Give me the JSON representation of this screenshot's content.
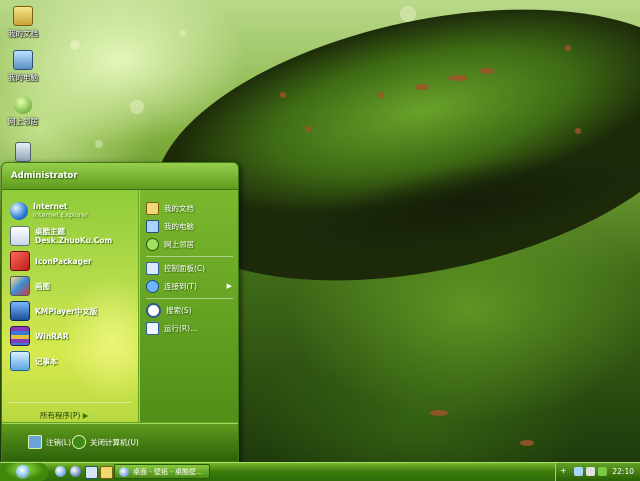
{
  "desktop": {
    "icons": [
      {
        "label": "我的文档",
        "icon": "my-documents-icon"
      },
      {
        "label": "我的电脑",
        "icon": "my-computer-icon"
      },
      {
        "label": "网上邻居",
        "icon": "network-places-icon"
      },
      {
        "label": "",
        "icon": "recycle-bin-icon"
      }
    ]
  },
  "start_menu": {
    "user": "Administrator",
    "pinned": [
      {
        "title": "Internet",
        "subtitle": "Internet Explorer",
        "icon": "internet-explorer-icon"
      },
      {
        "title": "桌酷主题Desk.ZhuoKu.Com",
        "icon": "zhuoku-icon"
      },
      {
        "title": "IconPackager",
        "icon": "iconpackager-icon"
      },
      {
        "title": "画图",
        "icon": "paint-icon"
      },
      {
        "title": "KMPlayer中文版",
        "icon": "kmplayer-icon"
      },
      {
        "title": "WinRAR",
        "icon": "winrar-icon"
      },
      {
        "title": "记事本",
        "icon": "notepad-icon"
      }
    ],
    "all_programs": "所有程序(P)",
    "right": [
      {
        "label": "我的文档",
        "icon": "my-documents-icon"
      },
      {
        "label": "我的电脑",
        "icon": "my-computer-icon"
      },
      {
        "label": "网上邻居",
        "icon": "network-places-icon"
      },
      {
        "label": "控制面板(C)",
        "icon": "control-panel-icon"
      },
      {
        "label": "连接到(T)",
        "icon": "connect-to-icon",
        "submenu": true
      },
      {
        "label": "搜索(S)",
        "icon": "search-icon"
      },
      {
        "label": "运行(R)...",
        "icon": "run-icon"
      }
    ],
    "logoff": "注销(L)",
    "shutdown": "关闭计算机(U)"
  },
  "taskbar": {
    "task_label": "桌面 - 壁纸 - 桌酷壁...",
    "clock": "22:10"
  },
  "colors": {
    "accent": "#5f9b1e",
    "taskbar": "#3e7f0f"
  }
}
